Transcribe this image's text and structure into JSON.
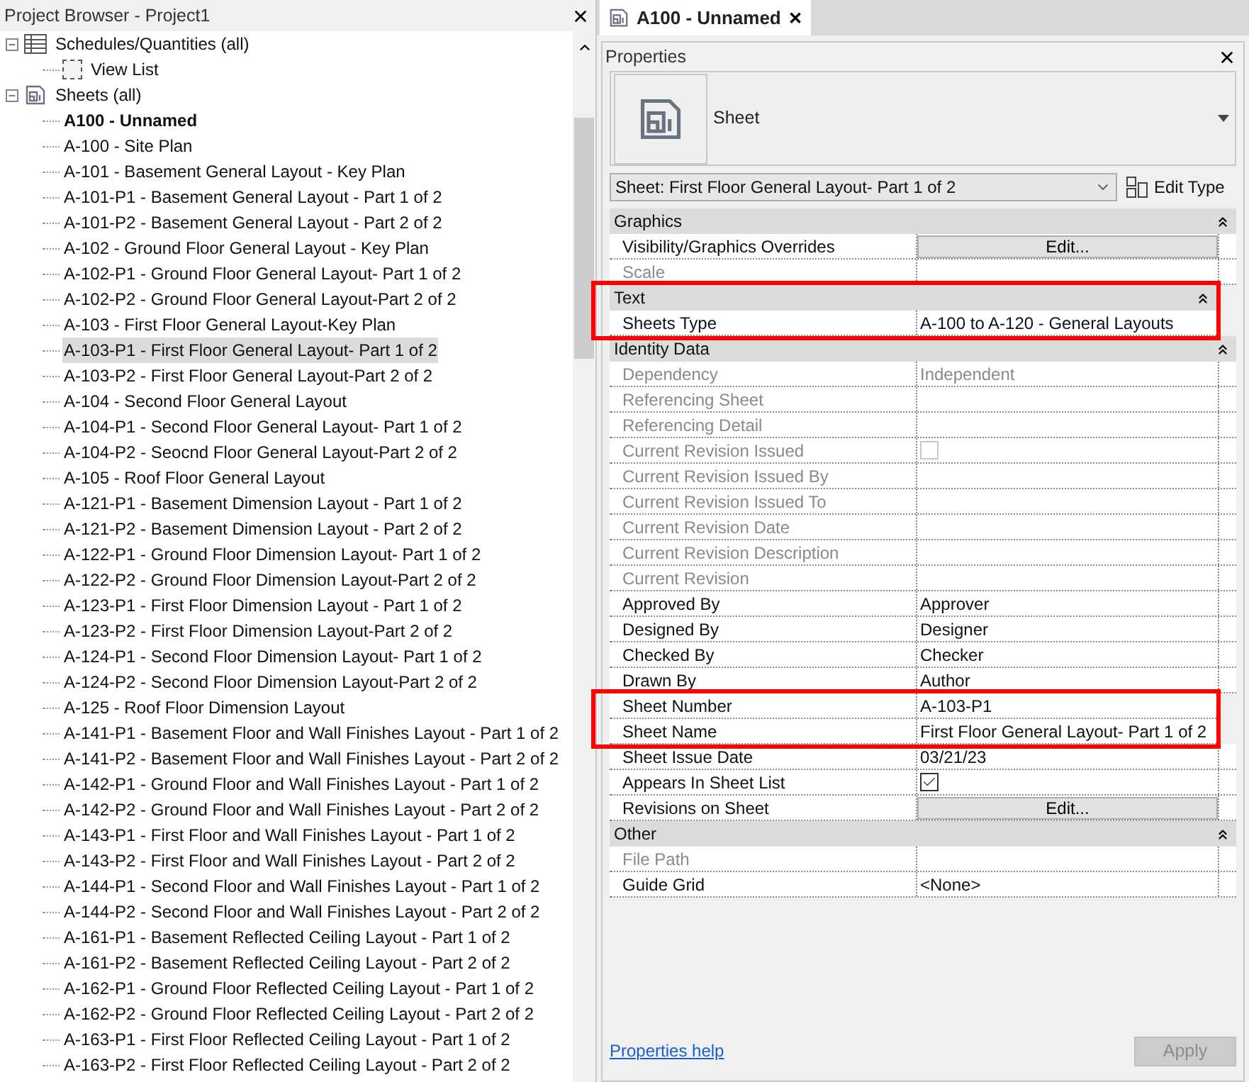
{
  "project_browser": {
    "title": "Project Browser - Project1",
    "tree": [
      {
        "label": "Schedules/Quantities (all)",
        "expanded": true,
        "selected": false,
        "current": false,
        "children": [
          {
            "label": "View List",
            "selected": false,
            "current": false
          }
        ]
      },
      {
        "label": "Sheets (all)",
        "expanded": true,
        "selected": false,
        "current": false,
        "children": [
          {
            "label": "A100 - Unnamed",
            "selected": false,
            "current": true
          },
          {
            "label": "A-100 - Site Plan",
            "selected": false,
            "current": false
          },
          {
            "label": "A-101 - Basement General Layout - Key Plan",
            "selected": false,
            "current": false
          },
          {
            "label": "A-101-P1 - Basement General Layout - Part 1 of 2",
            "selected": false,
            "current": false
          },
          {
            "label": "A-101-P2 - Basement General Layout - Part 2 of 2",
            "selected": false,
            "current": false
          },
          {
            "label": "A-102 - Ground Floor General Layout - Key Plan",
            "selected": false,
            "current": false
          },
          {
            "label": "A-102-P1 - Ground Floor General Layout- Part 1 of 2",
            "selected": false,
            "current": false
          },
          {
            "label": "A-102-P2 - Ground Floor General Layout-Part 2 of 2",
            "selected": false,
            "current": false
          },
          {
            "label": "A-103 - First Floor General Layout-Key Plan",
            "selected": false,
            "current": false
          },
          {
            "label": "A-103-P1 - First Floor General Layout- Part 1 of 2",
            "selected": true,
            "current": false
          },
          {
            "label": "A-103-P2 - First Floor General Layout-Part 2 of 2",
            "selected": false,
            "current": false
          },
          {
            "label": "A-104 - Second Floor General Layout",
            "selected": false,
            "current": false
          },
          {
            "label": "A-104-P1 - Second Floor General Layout- Part 1 of 2",
            "selected": false,
            "current": false
          },
          {
            "label": "A-104-P2 - Seocnd Floor General Layout-Part 2 of 2",
            "selected": false,
            "current": false
          },
          {
            "label": "A-105 - Roof Floor General Layout",
            "selected": false,
            "current": false
          },
          {
            "label": "A-121-P1 - Basement Dimension Layout - Part 1 of 2",
            "selected": false,
            "current": false
          },
          {
            "label": "A-121-P2 - Basement Dimension Layout - Part 2 of 2",
            "selected": false,
            "current": false
          },
          {
            "label": "A-122-P1 - Ground Floor Dimension Layout- Part 1 of 2",
            "selected": false,
            "current": false
          },
          {
            "label": "A-122-P2 - Ground Floor Dimension Layout-Part 2 of 2",
            "selected": false,
            "current": false
          },
          {
            "label": "A-123-P1 - First Floor Dimension Layout - Part 1 of 2",
            "selected": false,
            "current": false
          },
          {
            "label": "A-123-P2 - First Floor Dimension Layout-Part 2 of 2",
            "selected": false,
            "current": false
          },
          {
            "label": "A-124-P1 - Second Floor Dimension Layout- Part 1 of 2",
            "selected": false,
            "current": false
          },
          {
            "label": "A-124-P2 - Second Floor Dimension Layout-Part 2 of 2",
            "selected": false,
            "current": false
          },
          {
            "label": "A-125 - Roof Floor Dimension Layout",
            "selected": false,
            "current": false
          },
          {
            "label": "A-141-P1 - Basement Floor and Wall Finishes Layout - Part 1 of 2",
            "selected": false,
            "current": false
          },
          {
            "label": "A-141-P2 - Basement Floor and Wall Finishes Layout - Part 2 of 2",
            "selected": false,
            "current": false
          },
          {
            "label": "A-142-P1 - Ground Floor and Wall Finishes Layout - Part 1 of 2",
            "selected": false,
            "current": false
          },
          {
            "label": "A-142-P2 - Ground Floor and Wall Finishes Layout - Part 2 of 2",
            "selected": false,
            "current": false
          },
          {
            "label": "A-143-P1 - First Floor and Wall Finishes Layout - Part 1 of 2",
            "selected": false,
            "current": false
          },
          {
            "label": "A-143-P2 - First Floor and Wall Finishes Layout - Part 2 of 2",
            "selected": false,
            "current": false
          },
          {
            "label": "A-144-P1 - Second Floor and Wall Finishes Layout - Part 1 of 2",
            "selected": false,
            "current": false
          },
          {
            "label": "A-144-P2 - Second Floor and Wall Finishes Layout - Part 2 of 2",
            "selected": false,
            "current": false
          },
          {
            "label": "A-161-P1 - Basement Reflected Ceiling Layout - Part 1 of 2",
            "selected": false,
            "current": false
          },
          {
            "label": "A-161-P2 - Basement Reflected Ceiling Layout - Part 2 of 2",
            "selected": false,
            "current": false
          },
          {
            "label": "A-162-P1 - Ground Floor Reflected Ceiling Layout - Part 1 of 2",
            "selected": false,
            "current": false
          },
          {
            "label": "A-162-P2 - Ground Floor Reflected Ceiling Layout - Part 2 of 2",
            "selected": false,
            "current": false
          },
          {
            "label": "A-163-P1 - First Floor Reflected Ceiling Layout - Part 1 of 2",
            "selected": false,
            "current": false
          },
          {
            "label": "A-163-P2 - First Floor Reflected Ceiling Layout - Part 2 of 2",
            "selected": false,
            "current": false
          }
        ]
      }
    ]
  },
  "tab": {
    "label": "A100 - Unnamed",
    "close": "✕"
  },
  "properties": {
    "title": "Properties",
    "type_name": "Sheet",
    "instance": "Sheet: First Floor General Layout- Part 1 of 2",
    "edit_type": "Edit Type",
    "categories": [
      {
        "name": "Graphics",
        "outlined": false,
        "rows": [
          {
            "label": "Visibility/Graphics Overrides",
            "disabled": false,
            "outlined": false,
            "kind": "button",
            "value": "Edit..."
          },
          {
            "label": "Scale",
            "disabled": true,
            "outlined": false,
            "kind": "empty"
          }
        ]
      },
      {
        "name": "Text",
        "outlined": true,
        "rows": [
          {
            "label": "Sheets Type",
            "disabled": false,
            "outlined": true,
            "kind": "text",
            "value": "A-100 to A-120 - General Layouts"
          }
        ]
      },
      {
        "name": "Identity Data",
        "outlined": false,
        "rows": [
          {
            "label": "Dependency",
            "disabled": true,
            "outlined": false,
            "kind": "text",
            "value": "Independent"
          },
          {
            "label": "Referencing Sheet",
            "disabled": true,
            "outlined": false,
            "kind": "empty"
          },
          {
            "label": "Referencing Detail",
            "disabled": true,
            "outlined": false,
            "kind": "empty"
          },
          {
            "label": "Current Revision Issued",
            "disabled": true,
            "outlined": false,
            "kind": "checkbox",
            "checked": false
          },
          {
            "label": "Current Revision Issued By",
            "disabled": true,
            "outlined": false,
            "kind": "empty"
          },
          {
            "label": "Current Revision Issued To",
            "disabled": true,
            "outlined": false,
            "kind": "empty"
          },
          {
            "label": "Current Revision Date",
            "disabled": true,
            "outlined": false,
            "kind": "empty"
          },
          {
            "label": "Current Revision Description",
            "disabled": true,
            "outlined": false,
            "kind": "empty"
          },
          {
            "label": "Current Revision",
            "disabled": true,
            "outlined": false,
            "kind": "empty"
          },
          {
            "label": "Approved By",
            "disabled": false,
            "outlined": false,
            "kind": "text",
            "value": "Approver"
          },
          {
            "label": "Designed By",
            "disabled": false,
            "outlined": false,
            "kind": "text",
            "value": "Designer"
          },
          {
            "label": "Checked By",
            "disabled": false,
            "outlined": false,
            "kind": "text",
            "value": "Checker"
          },
          {
            "label": "Drawn By",
            "disabled": false,
            "outlined": false,
            "kind": "text",
            "value": "Author"
          },
          {
            "label": "Sheet Number",
            "disabled": false,
            "outlined": true,
            "kind": "text",
            "value": "A-103-P1"
          },
          {
            "label": "Sheet Name",
            "disabled": false,
            "outlined": true,
            "kind": "text",
            "value": "First Floor General Layout- Part 1 of 2"
          },
          {
            "label": "Sheet Issue Date",
            "disabled": false,
            "outlined": false,
            "kind": "text",
            "value": "03/21/23"
          },
          {
            "label": "Appears In Sheet List",
            "disabled": false,
            "outlined": false,
            "kind": "checkbox",
            "checked": true
          },
          {
            "label": "Revisions on Sheet",
            "disabled": false,
            "outlined": false,
            "kind": "button",
            "value": "Edit..."
          }
        ]
      },
      {
        "name": "Other",
        "outlined": false,
        "rows": [
          {
            "label": "File Path",
            "disabled": true,
            "outlined": false,
            "kind": "empty"
          },
          {
            "label": "Guide Grid",
            "disabled": false,
            "outlined": false,
            "kind": "text",
            "value": "<None>"
          }
        ]
      }
    ],
    "help_link": "Properties help",
    "apply": {
      "label": "Apply",
      "disabled": true
    }
  }
}
